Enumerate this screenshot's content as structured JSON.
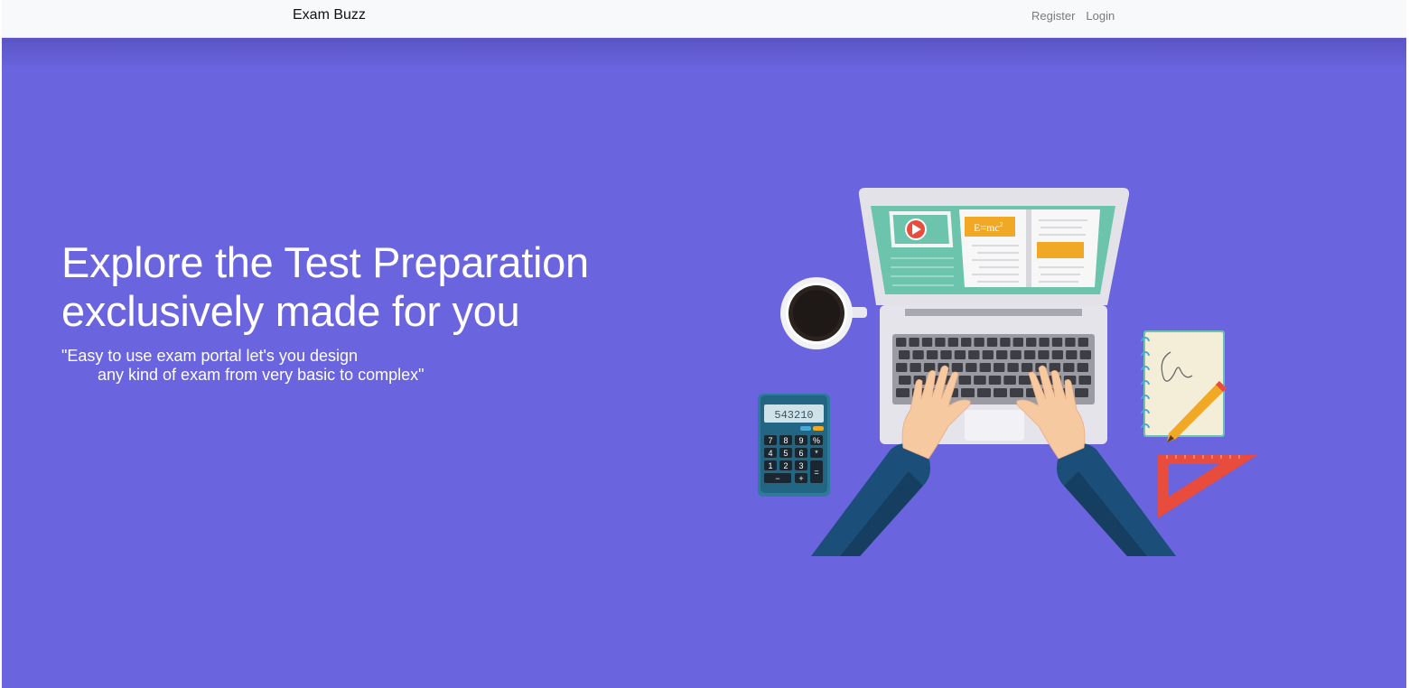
{
  "navbar": {
    "brand": "Exam Buzz",
    "links": [
      {
        "label": "Register"
      },
      {
        "label": "Login"
      }
    ]
  },
  "hero": {
    "title_line1": "Explore the Test Preparation",
    "title_line2": "exclusively made for you",
    "quote_line1": "\"Easy to use exam portal let's you design",
    "quote_line2": "any kind of exam from very basic to complex\""
  },
  "illustration": {
    "formula": "E=mc",
    "formula_exponent": "2",
    "calculator": {
      "display": "543210",
      "keys": [
        "7",
        "8",
        "9",
        "%",
        "4",
        "5",
        "6",
        "*",
        "1",
        "2",
        "3",
        "",
        "−",
        "+",
        "="
      ]
    }
  },
  "colors": {
    "background": "#6a64de",
    "navbar": "#f8f9fa",
    "screen_teal": "#6cc4ad",
    "accent_orange": "#f1a824",
    "accent_red": "#e74c3c",
    "sleeve_blue": "#1b4e78"
  }
}
